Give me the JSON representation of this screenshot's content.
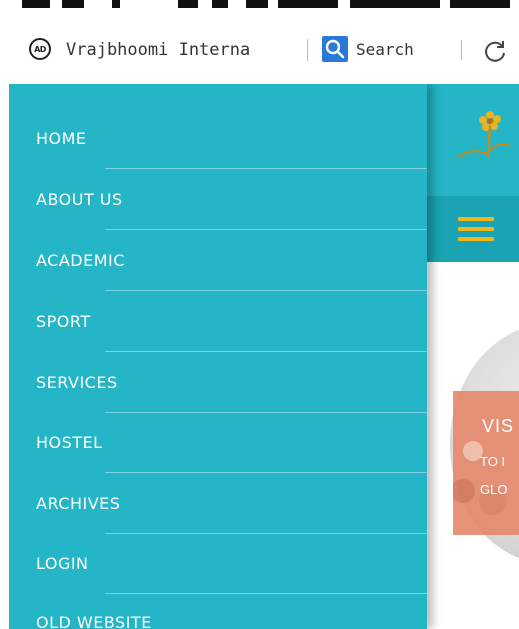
{
  "browser": {
    "ad_badge": "AD",
    "url": "Vrajbhoomi Interna",
    "search_label": "Search"
  },
  "colors": {
    "drawer_bg": "#24b5c7",
    "menu_strip": "#1aa3b3",
    "hamburger": "#f2b51a",
    "slide_overlay": "#e58a6e",
    "search_blue": "#2979d9"
  },
  "drawer": {
    "items": [
      {
        "label": "HOME"
      },
      {
        "label": "ABOUT US"
      },
      {
        "label": "ACADEMIC"
      },
      {
        "label": "SPORT"
      },
      {
        "label": "SERVICES"
      },
      {
        "label": "HOSTEL"
      },
      {
        "label": "ARCHIVES"
      },
      {
        "label": "LOGIN"
      },
      {
        "label": "OLD WEBSITE"
      }
    ]
  },
  "slide": {
    "title": "VIS",
    "sub1": "TO I",
    "sub2": "GLO"
  },
  "icons": {
    "refresh": "refresh-icon",
    "search": "search-icon",
    "menu": "hamburger-menu-icon",
    "logo": "flower-logo"
  }
}
